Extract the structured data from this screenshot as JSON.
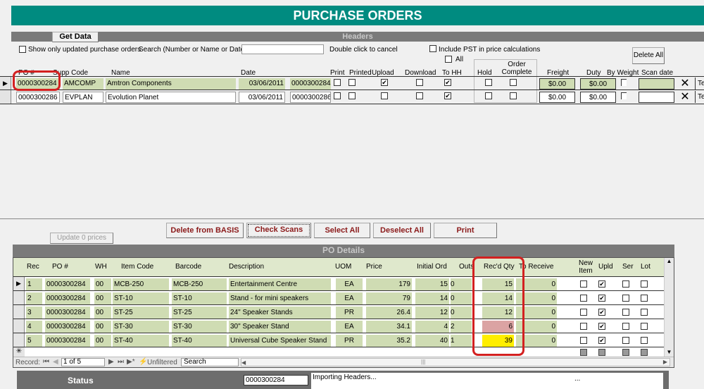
{
  "title": "PURCHASE ORDERS",
  "headers": {
    "bar_label": "Headers",
    "get_data": "Get Data",
    "show_updated": "Show only updated purchase orders",
    "search_label": "Search (Number or Name or Date )",
    "search_value": "",
    "cancel_hint": "Double click to cancel",
    "include_pst": "Include PST in price calculations",
    "all": "All",
    "delete_all": "Delete All",
    "columns": {
      "po": "PO #",
      "supp": "Supp Code",
      "name": "Name",
      "date": "Date",
      "print": "Print",
      "printed": "Printed",
      "upload": "Upload",
      "download": "Download",
      "tohh": "To HH",
      "hold": "Hold",
      "order_complete": "Order Complete",
      "freight": "Freight",
      "duty": "Duty",
      "by_weight": "By Weight",
      "scan_date": "Scan date"
    },
    "rows": [
      {
        "po": "0000300284",
        "supp": "AMCOMP",
        "name": "Amtron Components",
        "date": "03/06/2011",
        "po2": "0000300284",
        "print": false,
        "printed": false,
        "upload": true,
        "download": false,
        "tohh": true,
        "hold": false,
        "complete": false,
        "freight": "$0.00",
        "duty": "$0.00",
        "scan": "",
        "tab": "Te"
      },
      {
        "po": "0000300286",
        "supp": "EVPLAN",
        "name": "Evolution Planet",
        "date": "03/06/2011",
        "po2": "0000300286",
        "print": false,
        "printed": false,
        "upload": false,
        "download": false,
        "tohh": true,
        "hold": false,
        "complete": false,
        "freight": "$0.00",
        "duty": "$0.00",
        "scan": "",
        "tab": "Te"
      }
    ]
  },
  "actions": {
    "update_prices": "Update 0 prices",
    "delete_basis": "Delete from BASIS",
    "check_scans": "Check Scans",
    "select_all": "Select All",
    "deselect_all": "Deselect All",
    "print": "Print"
  },
  "details": {
    "bar_label": "PO Details",
    "columns": {
      "rec": "Rec",
      "po": "PO #",
      "wh": "WH",
      "item": "Item Code",
      "barcode": "Barcode",
      "desc": "Description",
      "uom": "UOM",
      "price": "Price",
      "init": "Initial Ord",
      "outs": "Outs",
      "recd": "Rec'd Qty",
      "torecv": "To Receive",
      "newitem": "New Item",
      "upld": "Upld",
      "ser": "Ser",
      "lot": "Lot"
    },
    "rows": [
      {
        "rec": "1",
        "po": "0000300284",
        "wh": "00",
        "item": "MCB-250",
        "barcode": "MCB-250",
        "desc": "Entertainment Centre",
        "uom": "EA",
        "price": "179",
        "init": "15",
        "outs": "0",
        "recd": "15",
        "torecv": "0",
        "recd_color": "#cfdcb3",
        "newitem": false,
        "upld": true,
        "ser": false,
        "lot": false
      },
      {
        "rec": "2",
        "po": "0000300284",
        "wh": "00",
        "item": "ST-10",
        "barcode": "ST-10",
        "desc": "Stand - for mini speakers",
        "uom": "EA",
        "price": "79",
        "init": "14",
        "outs": "0",
        "recd": "14",
        "torecv": "0",
        "recd_color": "#cfdcb3",
        "newitem": false,
        "upld": true,
        "ser": false,
        "lot": false
      },
      {
        "rec": "3",
        "po": "0000300284",
        "wh": "00",
        "item": "ST-25",
        "barcode": "ST-25",
        "desc": "24\" Speaker Stands",
        "uom": "PR",
        "price": "26.4",
        "init": "12",
        "outs": "0",
        "recd": "12",
        "torecv": "0",
        "recd_color": "#cfdcb3",
        "newitem": false,
        "upld": true,
        "ser": false,
        "lot": false
      },
      {
        "rec": "4",
        "po": "0000300284",
        "wh": "00",
        "item": "ST-30",
        "barcode": "ST-30",
        "desc": "30\" Speaker Stand",
        "uom": "EA",
        "price": "34.1",
        "init": "4",
        "outs": "2",
        "recd": "6",
        "torecv": "0",
        "recd_color": "#dba3a3",
        "newitem": false,
        "upld": true,
        "ser": false,
        "lot": false
      },
      {
        "rec": "5",
        "po": "0000300284",
        "wh": "00",
        "item": "ST-40",
        "barcode": "ST-40",
        "desc": "Universal Cube Speaker Stand",
        "uom": "PR",
        "price": "35.2",
        "init": "40",
        "outs": "1",
        "recd": "39",
        "torecv": "0",
        "recd_color": "#ffee00",
        "newitem": false,
        "upld": true,
        "ser": false,
        "lot": false
      }
    ],
    "nav": {
      "record_label": "Record:",
      "position": "1 of 5",
      "filter": "Unfiltered",
      "search": "Search"
    }
  },
  "status": {
    "label": "Status",
    "po": "0000300284",
    "message": "Importing Headers...",
    "extra": "..."
  }
}
